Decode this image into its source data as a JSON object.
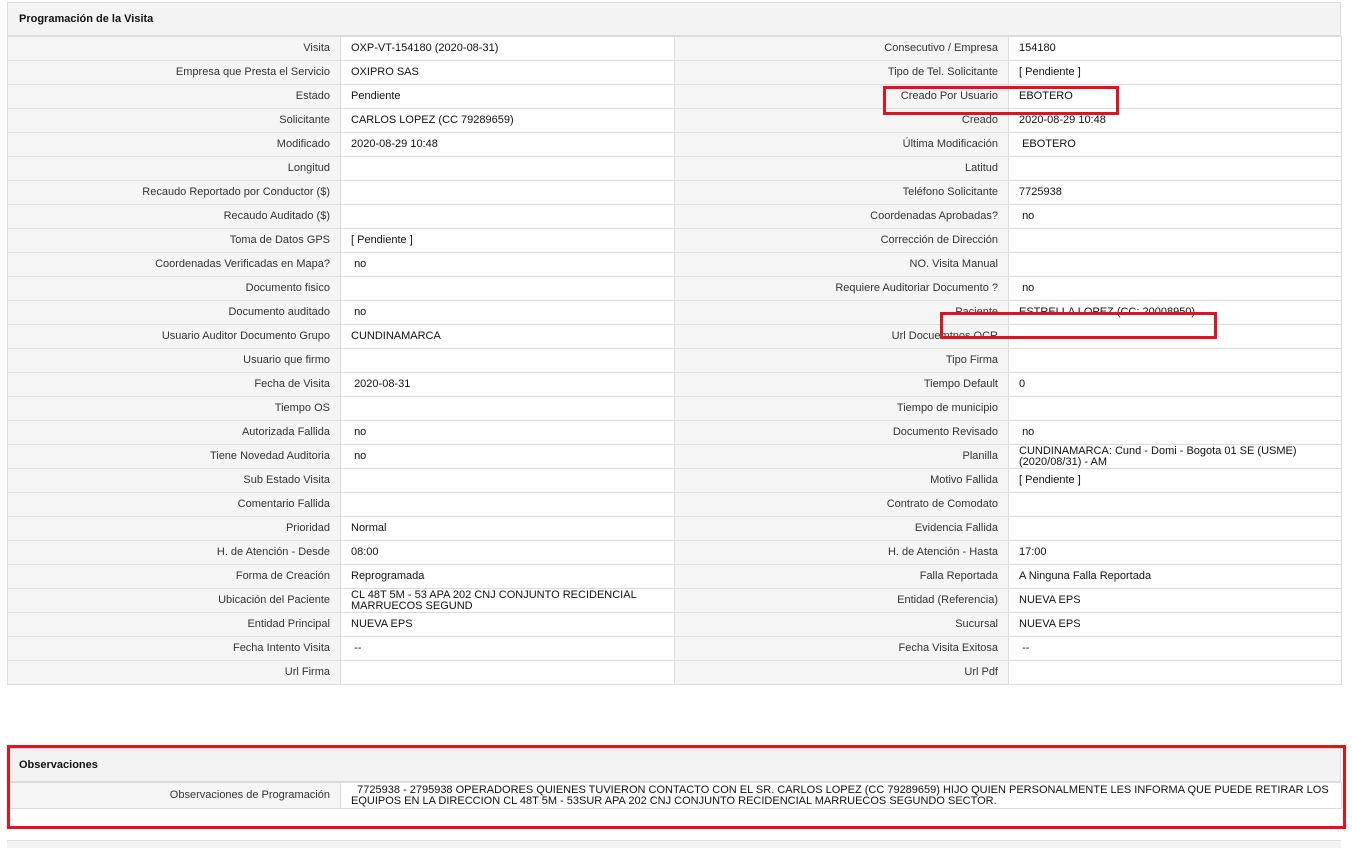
{
  "programacion": {
    "title": "Programación de la Visita",
    "rows": [
      [
        {
          "label": "Visita",
          "value": "OXP-VT-154180 (2020-08-31)"
        },
        {
          "label": "Consecutivo / Empresa",
          "value": "154180"
        }
      ],
      [
        {
          "label": "Empresa que Presta el Servicio",
          "value": "OXIPRO SAS"
        },
        {
          "label": "Tipo de Tel. Solicitante",
          "value": "[ Pendiente ]"
        }
      ],
      [
        {
          "label": "Estado",
          "value": "Pendiente"
        },
        {
          "label": "Creado Por Usuario",
          "value": "EBOTERO"
        }
      ],
      [
        {
          "label": "Solicitante",
          "value": "CARLOS LOPEZ (CC 79289659)"
        },
        {
          "label": "Creado",
          "value": "2020-08-29 10:48"
        }
      ],
      [
        {
          "label": "Modificado",
          "value": "2020-08-29 10:48"
        },
        {
          "label": "Última Modificación",
          "value": " EBOTERO"
        }
      ],
      [
        {
          "label": "Longitud",
          "value": ""
        },
        {
          "label": "Latitud",
          "value": ""
        }
      ],
      [
        {
          "label": "Recaudo Reportado por Conductor ($)",
          "value": ""
        },
        {
          "label": "Teléfono Solicitante",
          "value": "7725938"
        }
      ],
      [
        {
          "label": "Recaudo Auditado ($)",
          "value": ""
        },
        {
          "label": "Coordenadas Aprobadas?",
          "value": " no"
        }
      ],
      [
        {
          "label": "Toma de Datos GPS",
          "value": "[ Pendiente ]"
        },
        {
          "label": "Corrección de Dirección",
          "value": ""
        }
      ],
      [
        {
          "label": "Coordenadas Verificadas en Mapa?",
          "value": " no"
        },
        {
          "label": "NO. Visita Manual",
          "value": ""
        }
      ],
      [
        {
          "label": "Documento fisico",
          "value": ""
        },
        {
          "label": "Requiere Auditoriar Documento ?",
          "value": " no"
        }
      ],
      [
        {
          "label": "Documento auditado",
          "value": " no"
        },
        {
          "label": "Paciente",
          "value": "ESTRELLA LOPEZ (CC: 20008950)"
        }
      ],
      [
        {
          "label": "Usuario Auditor Documento Grupo",
          "value": "CUNDINAMARCA"
        },
        {
          "label": "Url Docuemtnos OCR",
          "value": ""
        }
      ],
      [
        {
          "label": "Usuario que firmo",
          "value": ""
        },
        {
          "label": "Tipo Firma",
          "value": ""
        }
      ],
      [
        {
          "label": "Fecha de Visita",
          "value": " 2020-08-31"
        },
        {
          "label": "Tiempo Default",
          "value": "0"
        }
      ],
      [
        {
          "label": "Tiempo OS",
          "value": ""
        },
        {
          "label": "Tiempo de municipio",
          "value": ""
        }
      ],
      [
        {
          "label": "Autorizada Fallida",
          "value": " no"
        },
        {
          "label": "Documento Revisado",
          "value": " no"
        }
      ],
      [
        {
          "label": "Tiene Novedad Auditoria",
          "value": " no"
        },
        {
          "label": "Planilla",
          "value": "CUNDINAMARCA: Cund - Domi - Bogota 01 SE (USME) (2020/08/31) - AM"
        }
      ],
      [
        {
          "label": "Sub Estado Visita",
          "value": ""
        },
        {
          "label": "Motivo Fallida",
          "value": "[ Pendiente ]"
        }
      ],
      [
        {
          "label": "Comentario Fallida",
          "value": ""
        },
        {
          "label": "Contrato de Comodato",
          "value": ""
        }
      ],
      [
        {
          "label": "Prioridad",
          "value": "Normal"
        },
        {
          "label": "Evidencia Fallida",
          "value": ""
        }
      ],
      [
        {
          "label": "H. de Atención - Desde",
          "value": "08:00"
        },
        {
          "label": "H. de Atención - Hasta",
          "value": "17:00"
        }
      ],
      [
        {
          "label": "Forma de Creación",
          "value": "Reprogramada"
        },
        {
          "label": "Falla Reportada",
          "value": "A Ninguna Falla Reportada"
        }
      ],
      [
        {
          "label": "Ubicación del Paciente",
          "value": "CL 48T 5M - 53 APA 202 CNJ CONJUNTO RECIDENCIAL MARRUECOS SEGUND"
        },
        {
          "label": "Entidad (Referencia)",
          "value": "NUEVA EPS"
        }
      ],
      [
        {
          "label": "Entidad Principal",
          "value": "NUEVA EPS"
        },
        {
          "label": "Sucursal",
          "value": "NUEVA EPS"
        }
      ],
      [
        {
          "label": "Fecha Intento Visita",
          "value": " --"
        },
        {
          "label": "Fecha Visita Exitosa",
          "value": " --"
        }
      ],
      [
        {
          "label": "Url Firma",
          "value": ""
        },
        {
          "label": "Url Pdf",
          "value": ""
        }
      ]
    ]
  },
  "observaciones": {
    "title": "Observaciones",
    "label": "Observaciones de Programación",
    "value": "  7725938 - 2795938 OPERADORES QUIENES TUVIERON CONTACTO CON EL SR. CARLOS LOPEZ (CC 79289659) HIJO QUIEN PERSONALMENTE LES INFORMA QUE PUEDE RETIRAR LOS EQUIPOS EN LA DIRECCION CL 48T 5M - 53SUR APA 202 CNJ CONJUNTO RECIDENCIAL MARRUECOS SEGUNDO SECTOR."
  },
  "highlight_color": "#e0141e"
}
